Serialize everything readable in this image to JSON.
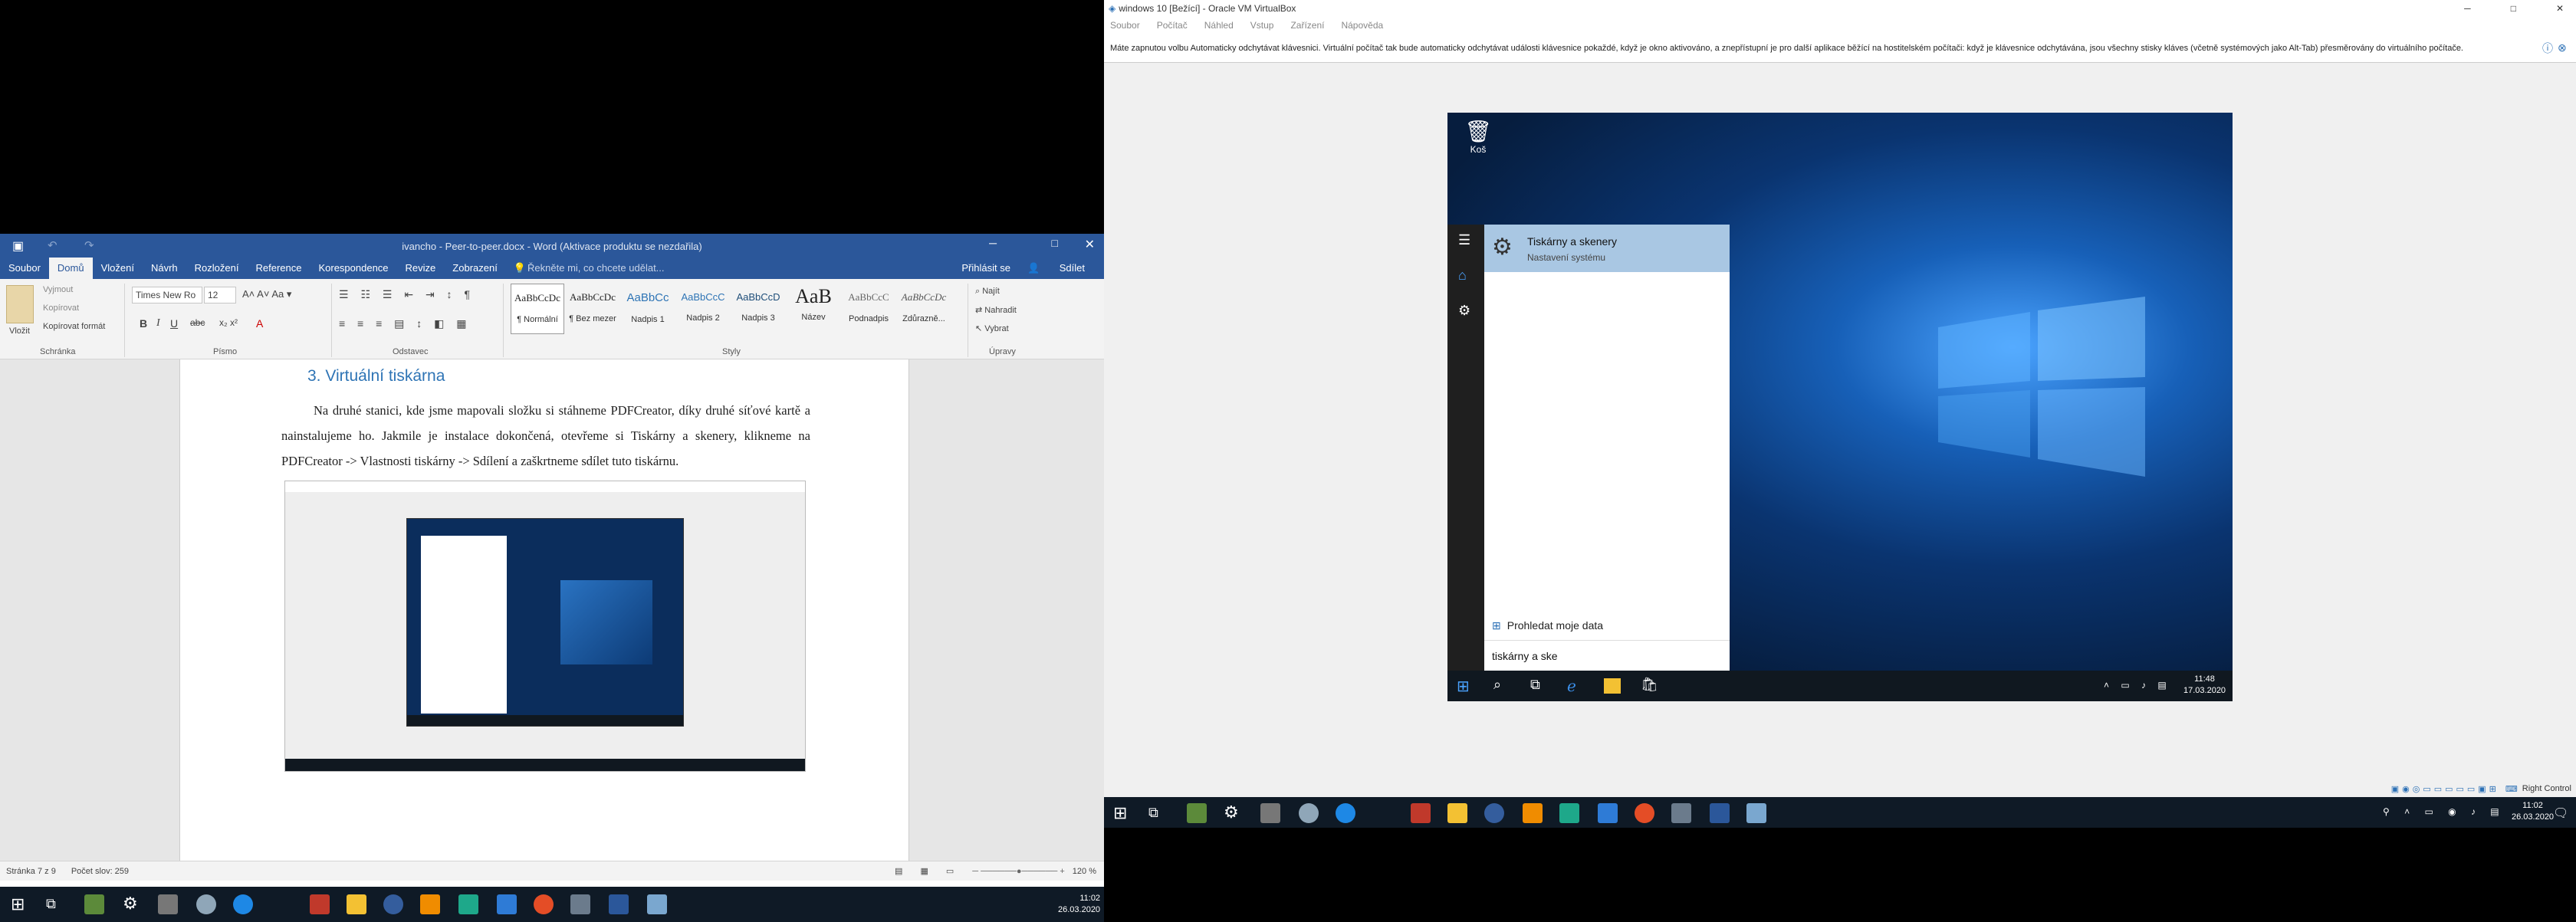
{
  "word": {
    "title": "ivancho - Peer-to-peer.docx - Word (Aktivace produktu se nezdařila)",
    "tabs": [
      "Soubor",
      "Domů",
      "Vložení",
      "Návrh",
      "Rozložení",
      "Reference",
      "Korespondence",
      "Revize",
      "Zobrazení"
    ],
    "tell_me": "Řekněte mi, co chcete udělat...",
    "sign_in": "Přihlásit se",
    "share": "Sdílet",
    "clipboard": {
      "paste": "Vložit",
      "cut": "Vyjmout",
      "copy": "Kopírovat",
      "format": "Kopírovat formát",
      "label": "Schránka"
    },
    "font": {
      "name": "Times New Ro",
      "size": "12",
      "label": "Písmo"
    },
    "paragraph_label": "Odstavec",
    "styles": [
      {
        "preview": "AaBbCcDc",
        "name": "¶ Normální"
      },
      {
        "preview": "AaBbCcDc",
        "name": "¶ Bez mezer"
      },
      {
        "preview": "AaBbCc",
        "name": "Nadpis 1"
      },
      {
        "preview": "AaBbCcC",
        "name": "Nadpis 2"
      },
      {
        "preview": "AaBbCcD",
        "name": "Nadpis 3"
      },
      {
        "preview": "AaB",
        "name": "Název"
      },
      {
        "preview": "AaBbCcC",
        "name": "Podnadpis"
      },
      {
        "preview": "AaBbCcDc",
        "name": "Zdůrazně..."
      }
    ],
    "styles_label": "Styly",
    "editing": {
      "find": "Najít",
      "replace": "Nahradit",
      "select": "Vybrat",
      "label": "Úpravy"
    },
    "heading": "3.  Virtuální tiskárna",
    "paragraph": "Na druhé stanici, kde jsme mapovali složku si stáhneme PDFCreator, díky druhé síťové kartě a nainstalujeme ho. Jakmile je instalace dokončená, otevřeme si Tiskárny a skenery, klikneme na PDFCreator -> Vlastnosti tiskárny -> Sdílení a zaškrtneme sdílet tuto tiskárnu.",
    "status": {
      "page": "Stránka 7 z 9",
      "words": "Počet slov: 259",
      "zoom": "120 %"
    }
  },
  "vbox": {
    "title": "windows 10 [Bežící] - Oracle VM VirtualBox",
    "menu": [
      "Soubor",
      "Počítač",
      "Náhled",
      "Vstup",
      "Zařízení",
      "Nápověda"
    ],
    "notice": "Máte zapnutou volbu Automaticky odchytávat klávesnici. Virtuální počítač tak bude automaticky odchytávat události klávesnice pokaždé, když je okno aktivováno, a znepřístupní je pro další aplikace běžící na hostitelském počítači: když je klávesnice odchytávána, jsou všechny stisky kláves (včetně systémových jako Alt-Tab) přesměrovány do virtuálního počítače.",
    "host_key": "Right Control",
    "vm": {
      "recycle_bin": "Koš",
      "result_title": "Tiskárny a skenery",
      "result_subtitle": "Nastavení systému",
      "search_my_data": "Prohledat moje data",
      "search_query": "tiskárny a ske",
      "clock_time": "11:48",
      "clock_date": "17.03.2020"
    }
  },
  "host_clock": {
    "time": "11:02",
    "date": "26.03.2020"
  },
  "colors": {
    "word_blue": "#2b579a",
    "heading_blue": "#2e74b5",
    "taskbar": "#0f1a26",
    "vm_desktop": "#0a2a55"
  }
}
